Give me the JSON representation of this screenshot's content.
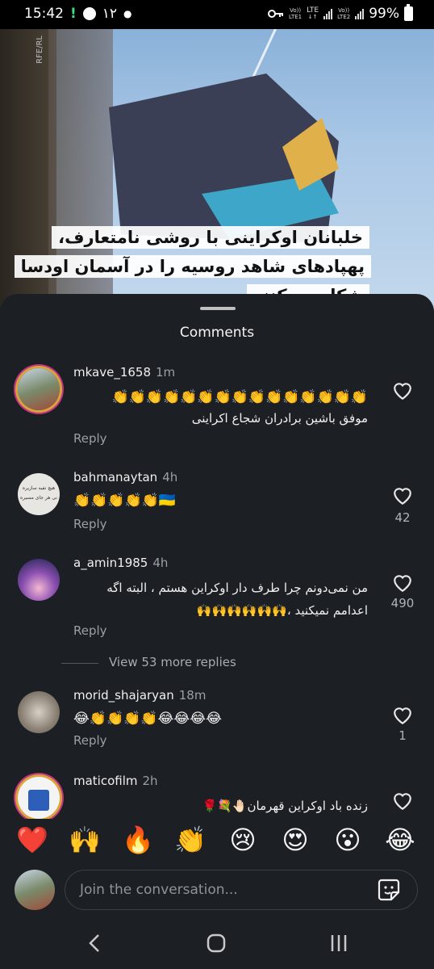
{
  "status_bar": {
    "time": "15:42",
    "notif_count": "۱۲",
    "network_left": "LTE1",
    "network_right": "LTE2",
    "lte_label": "LTE",
    "volte": "Vo))",
    "battery": "99%"
  },
  "video": {
    "watermark": "RFE/RL",
    "caption_lines": [
      "خلبانان اوکراینی با روشی نامتعارف،",
      "پهپادهای شاهد روسیه را در آسمان اودسا",
      "شکار می‌کنند"
    ]
  },
  "sheet": {
    "title": "Comments",
    "comments": [
      {
        "username": "mkave_1658",
        "time": "1m",
        "text_line1": "👏👏👏👏👏👏👏👏👏👏👏👏👏👏👏",
        "text_line2": "موفق باشین برادران شجاع اکراینی",
        "reply": "Reply",
        "likes": ""
      },
      {
        "username": "bahmanaytan",
        "time": "4h",
        "text": "👏👏👏👏👏🇺🇦",
        "reply": "Reply",
        "likes": "42"
      },
      {
        "username": "a_amin1985",
        "time": "4h",
        "text_line1": "من نمی‌دونم چرا طرف دار اوکراین هستم ، البته اگه",
        "text_line2": "اعدامم نمیکنید ،🙌🙌🙌🙌🙌🙌",
        "reply": "Reply",
        "likes": "490"
      },
      {
        "username": "morid_shajaryan",
        "time": "18m",
        "text": "😂👏👏👏👏😂😂😂😂",
        "reply": "Reply",
        "likes": "1"
      },
      {
        "username": "maticofilm",
        "time": "2h",
        "text": "زنده باد اوکراین قهرمان🤚🏻💐🌹",
        "reply": "",
        "likes": ""
      }
    ],
    "view_more": "View 53 more replies",
    "avatar2_text_line1": "هیچ نفیه سازیره",
    "avatar2_text_line2": "نی هر جای مسیره"
  },
  "emoji_bar": [
    "❤️",
    "🙌",
    "🔥",
    "👏",
    "😢",
    "😍",
    "😮",
    "😂"
  ],
  "composer": {
    "placeholder": "Join the conversation...",
    "sticker_icon": "sticker-icon"
  },
  "navbar": {
    "recents_icon": "recents-icon",
    "home_icon": "home-icon",
    "back_icon": "back-icon"
  },
  "colors": {
    "sheet_bg": "#1c1f23",
    "heart_outline": "#e8e8e8",
    "muted": "#9aa0a6"
  }
}
